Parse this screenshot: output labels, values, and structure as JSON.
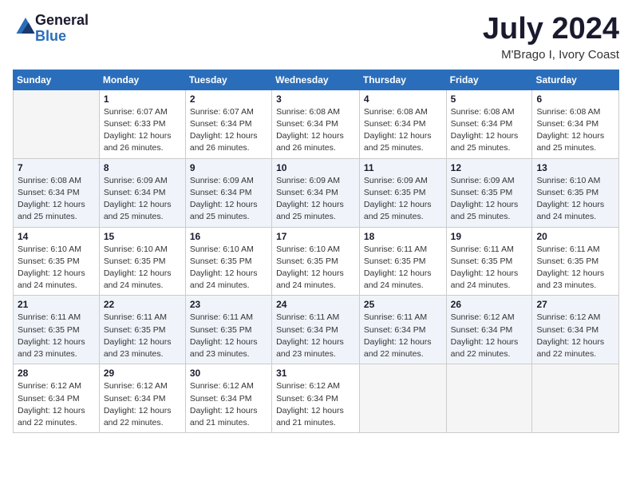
{
  "logo": {
    "general": "General",
    "blue": "Blue"
  },
  "title": "July 2024",
  "subtitle": "M'Brago I, Ivory Coast",
  "days_of_week": [
    "Sunday",
    "Monday",
    "Tuesday",
    "Wednesday",
    "Thursday",
    "Friday",
    "Saturday"
  ],
  "weeks": [
    [
      {
        "day": "",
        "info": ""
      },
      {
        "day": "1",
        "info": "Sunrise: 6:07 AM\nSunset: 6:33 PM\nDaylight: 12 hours\nand 26 minutes."
      },
      {
        "day": "2",
        "info": "Sunrise: 6:07 AM\nSunset: 6:34 PM\nDaylight: 12 hours\nand 26 minutes."
      },
      {
        "day": "3",
        "info": "Sunrise: 6:08 AM\nSunset: 6:34 PM\nDaylight: 12 hours\nand 26 minutes."
      },
      {
        "day": "4",
        "info": "Sunrise: 6:08 AM\nSunset: 6:34 PM\nDaylight: 12 hours\nand 25 minutes."
      },
      {
        "day": "5",
        "info": "Sunrise: 6:08 AM\nSunset: 6:34 PM\nDaylight: 12 hours\nand 25 minutes."
      },
      {
        "day": "6",
        "info": "Sunrise: 6:08 AM\nSunset: 6:34 PM\nDaylight: 12 hours\nand 25 minutes."
      }
    ],
    [
      {
        "day": "7",
        "info": "Sunrise: 6:08 AM\nSunset: 6:34 PM\nDaylight: 12 hours\nand 25 minutes."
      },
      {
        "day": "8",
        "info": "Sunrise: 6:09 AM\nSunset: 6:34 PM\nDaylight: 12 hours\nand 25 minutes."
      },
      {
        "day": "9",
        "info": "Sunrise: 6:09 AM\nSunset: 6:34 PM\nDaylight: 12 hours\nand 25 minutes."
      },
      {
        "day": "10",
        "info": "Sunrise: 6:09 AM\nSunset: 6:34 PM\nDaylight: 12 hours\nand 25 minutes."
      },
      {
        "day": "11",
        "info": "Sunrise: 6:09 AM\nSunset: 6:35 PM\nDaylight: 12 hours\nand 25 minutes."
      },
      {
        "day": "12",
        "info": "Sunrise: 6:09 AM\nSunset: 6:35 PM\nDaylight: 12 hours\nand 25 minutes."
      },
      {
        "day": "13",
        "info": "Sunrise: 6:10 AM\nSunset: 6:35 PM\nDaylight: 12 hours\nand 24 minutes."
      }
    ],
    [
      {
        "day": "14",
        "info": "Sunrise: 6:10 AM\nSunset: 6:35 PM\nDaylight: 12 hours\nand 24 minutes."
      },
      {
        "day": "15",
        "info": "Sunrise: 6:10 AM\nSunset: 6:35 PM\nDaylight: 12 hours\nand 24 minutes."
      },
      {
        "day": "16",
        "info": "Sunrise: 6:10 AM\nSunset: 6:35 PM\nDaylight: 12 hours\nand 24 minutes."
      },
      {
        "day": "17",
        "info": "Sunrise: 6:10 AM\nSunset: 6:35 PM\nDaylight: 12 hours\nand 24 minutes."
      },
      {
        "day": "18",
        "info": "Sunrise: 6:11 AM\nSunset: 6:35 PM\nDaylight: 12 hours\nand 24 minutes."
      },
      {
        "day": "19",
        "info": "Sunrise: 6:11 AM\nSunset: 6:35 PM\nDaylight: 12 hours\nand 24 minutes."
      },
      {
        "day": "20",
        "info": "Sunrise: 6:11 AM\nSunset: 6:35 PM\nDaylight: 12 hours\nand 23 minutes."
      }
    ],
    [
      {
        "day": "21",
        "info": "Sunrise: 6:11 AM\nSunset: 6:35 PM\nDaylight: 12 hours\nand 23 minutes."
      },
      {
        "day": "22",
        "info": "Sunrise: 6:11 AM\nSunset: 6:35 PM\nDaylight: 12 hours\nand 23 minutes."
      },
      {
        "day": "23",
        "info": "Sunrise: 6:11 AM\nSunset: 6:35 PM\nDaylight: 12 hours\nand 23 minutes."
      },
      {
        "day": "24",
        "info": "Sunrise: 6:11 AM\nSunset: 6:34 PM\nDaylight: 12 hours\nand 23 minutes."
      },
      {
        "day": "25",
        "info": "Sunrise: 6:11 AM\nSunset: 6:34 PM\nDaylight: 12 hours\nand 22 minutes."
      },
      {
        "day": "26",
        "info": "Sunrise: 6:12 AM\nSunset: 6:34 PM\nDaylight: 12 hours\nand 22 minutes."
      },
      {
        "day": "27",
        "info": "Sunrise: 6:12 AM\nSunset: 6:34 PM\nDaylight: 12 hours\nand 22 minutes."
      }
    ],
    [
      {
        "day": "28",
        "info": "Sunrise: 6:12 AM\nSunset: 6:34 PM\nDaylight: 12 hours\nand 22 minutes."
      },
      {
        "day": "29",
        "info": "Sunrise: 6:12 AM\nSunset: 6:34 PM\nDaylight: 12 hours\nand 22 minutes."
      },
      {
        "day": "30",
        "info": "Sunrise: 6:12 AM\nSunset: 6:34 PM\nDaylight: 12 hours\nand 21 minutes."
      },
      {
        "day": "31",
        "info": "Sunrise: 6:12 AM\nSunset: 6:34 PM\nDaylight: 12 hours\nand 21 minutes."
      },
      {
        "day": "",
        "info": ""
      },
      {
        "day": "",
        "info": ""
      },
      {
        "day": "",
        "info": ""
      }
    ]
  ]
}
